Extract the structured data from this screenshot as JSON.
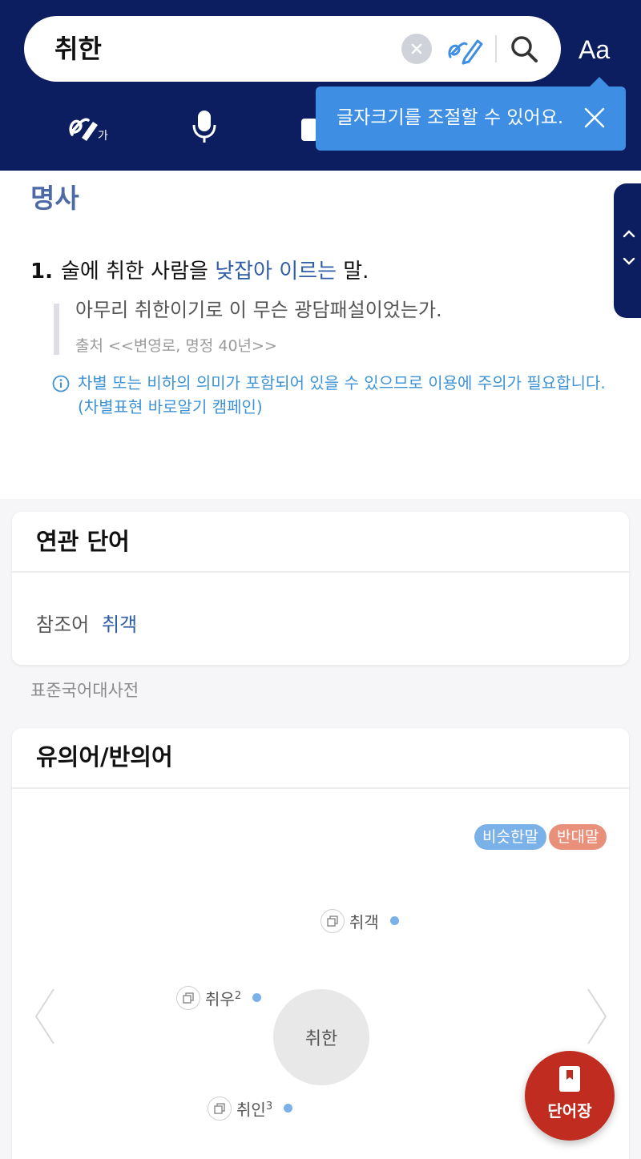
{
  "search": {
    "query": "취한"
  },
  "header": {
    "font_size_button": "Aa"
  },
  "tooltip": {
    "text": "글자크기를 조절할 수 있어요."
  },
  "entry": {
    "part_of_speech": "명사",
    "definition": {
      "number": "1.",
      "prefix": "술에 취한 사람을 ",
      "link": "낮잡아 이르는",
      "suffix": " 말."
    },
    "example": {
      "text": "아무리 취한이기로 이 무슨 광담패설이었는가.",
      "source": "출처 <<변영로, 명정 40년>>"
    },
    "warning": "차별 또는 비하의 의미가 포함되어 있을 수 있으므로 이용에 주의가 필요합니다. (차별표현 바로알기 캠페인)"
  },
  "related": {
    "title": "연관 단어",
    "label": "참조어",
    "value": "취객"
  },
  "source_note": "표준국어대사전",
  "synonyms": {
    "title": "유의어/반의어",
    "legend_synonym": "비슷한말",
    "legend_antonym": "반대말",
    "center": "취한",
    "nodes": [
      {
        "word": "취객",
        "sup": ""
      },
      {
        "word": "취우",
        "sup": "2"
      },
      {
        "word": "취인",
        "sup": "3"
      }
    ]
  },
  "vocab_button": {
    "label": "단어장"
  },
  "colors": {
    "header_bg": "#0d1e60",
    "tooltip_bg": "#3e8fe3",
    "link": "#2f5da6",
    "synonym": "#7ab1e8",
    "antonym": "#e8907a",
    "vocab_button": "#c02c1f"
  }
}
